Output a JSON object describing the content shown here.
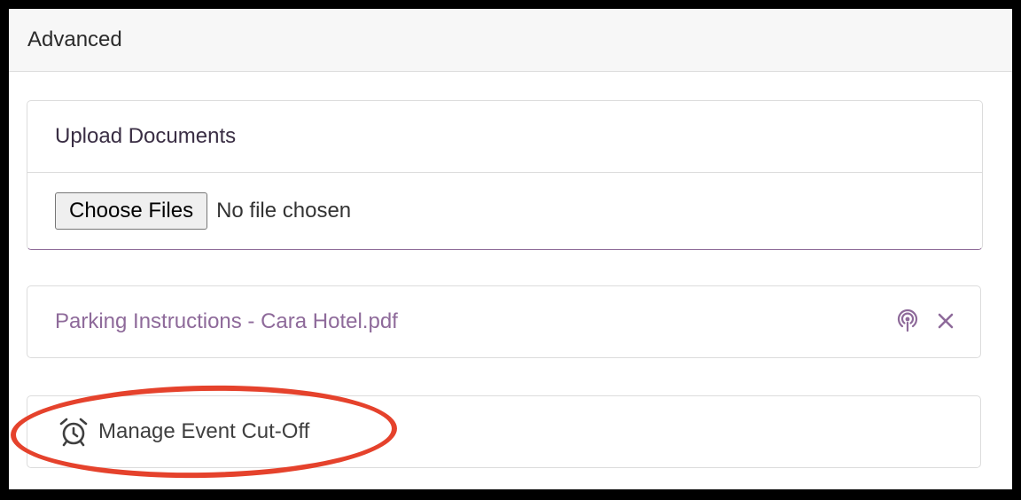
{
  "panel": {
    "title": "Advanced"
  },
  "upload": {
    "title": "Upload Documents",
    "button_label": "Choose Files",
    "status_text": "No file chosen"
  },
  "documents": [
    {
      "name": "Parking Instructions - Cara Hotel.pdf",
      "actions": [
        "broadcast-icon",
        "close-icon"
      ]
    }
  ],
  "cutoff": {
    "label": "Manage Event Cut-Off",
    "icon": "alarm-clock-icon"
  },
  "colors": {
    "accent": "#8e6a9a",
    "highlight": "#e5422c"
  }
}
